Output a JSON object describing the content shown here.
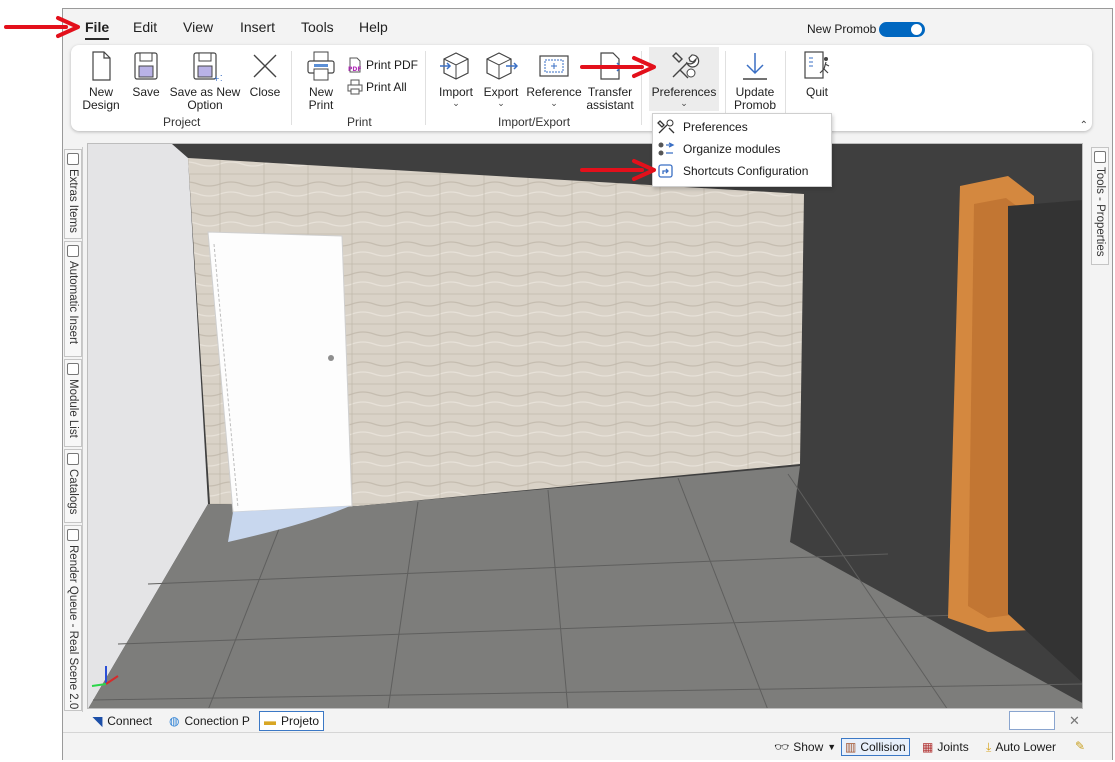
{
  "menu": {
    "items": [
      "File",
      "Edit",
      "View",
      "Insert",
      "Tools",
      "Help"
    ],
    "active": "File",
    "promob_label": "New Promob",
    "promob_toggle_on": true
  },
  "ribbon": {
    "buttons": {
      "new_design": "New\nDesign",
      "save": "Save",
      "save_as_new_option": "Save as New\nOption",
      "close": "Close",
      "new_print": "New\nPrint",
      "print_pdf": "Print PDF",
      "print_all": "Print All",
      "import": "Import",
      "export": "Export",
      "reference": "Reference",
      "transfer_assistant": "Transfer\nassistant",
      "preferences": "Preferences",
      "update_promob": "Update\nPromob",
      "quit": "Quit"
    },
    "groups": [
      "Project",
      "Print",
      "Import/Export"
    ]
  },
  "preferences_menu": {
    "items": [
      "Preferences",
      "Organize modules",
      "Shortcuts Configuration"
    ]
  },
  "left_panel_tabs": [
    "Extras Items",
    "Automatic Insert",
    "Module List",
    "Catalogs",
    "Render Queue - Real Scene 2.0"
  ],
  "right_panel_tabs": [
    "Tools - Properties"
  ],
  "doc_tabs": [
    "Connect",
    "Conection P",
    "Projeto"
  ],
  "active_doc_tab": "Projeto",
  "status_bar": {
    "show": "Show",
    "collision": "Collision",
    "joints": "Joints",
    "auto_lower": "Auto Lower"
  },
  "colors": {
    "accent": "#0067c0",
    "annotation_arrow": "#e3101b",
    "viewport_wall": "#3f3f3f",
    "wall_tile": "#d9d2c7",
    "floor_tile": "#7d7d7b",
    "door_frame": "#d4883f"
  }
}
